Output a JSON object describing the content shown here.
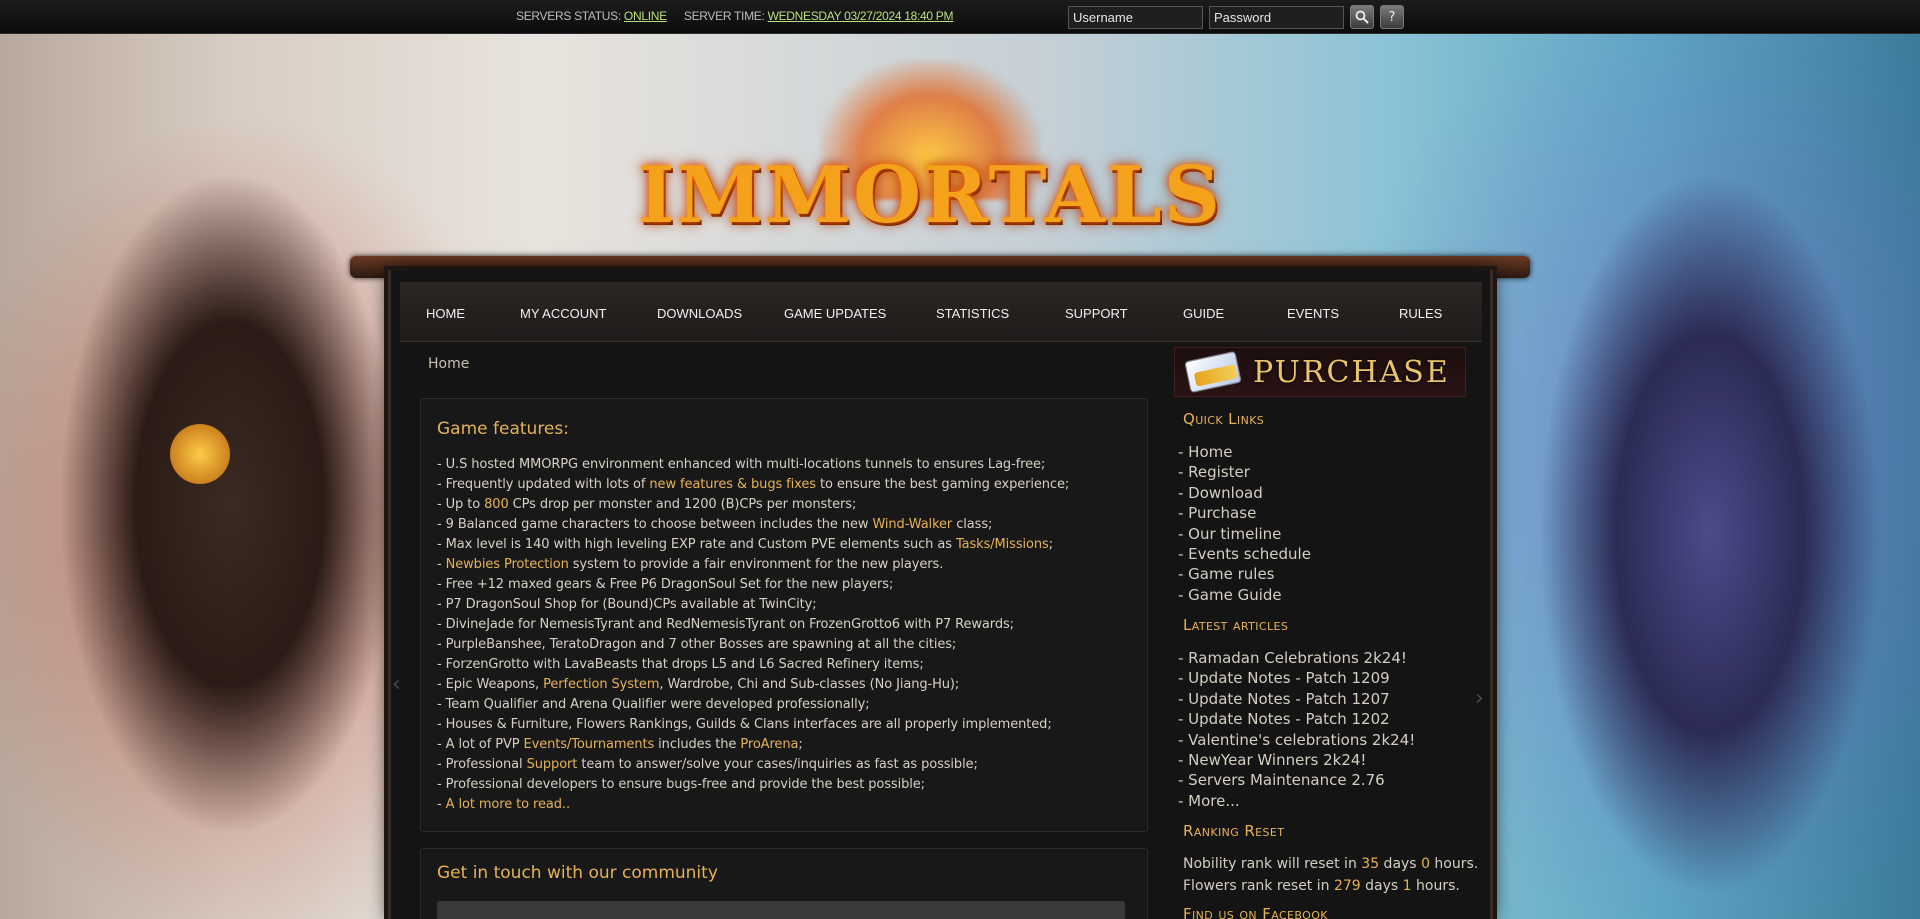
{
  "topbar": {
    "status_label": "SERVERS STATUS:",
    "status_value": "ONLINE",
    "time_label": "SERVER TIME:",
    "time_value": "WEDNESDAY 03/27/2024 18:40 PM",
    "username_placeholder": "Username",
    "password_placeholder": "Password",
    "login_icon": "search-icon",
    "help_icon": "question-icon",
    "help_glyph": "?"
  },
  "logo": {
    "text": "IMMORTALS"
  },
  "nav": {
    "items": [
      "HOME",
      "MY ACCOUNT",
      "DOWNLOADS",
      "GAME UPDATES",
      "STATISTICS",
      "SUPPORT",
      "GUIDE",
      "EVENTS",
      "RULES"
    ]
  },
  "breadcrumb": "Home",
  "features": {
    "title": "Game features:",
    "lines": [
      [
        {
          "t": "- U.S hosted MMORPG environment enhanced with multi-locations tunnels to ensures Lag-free;"
        }
      ],
      [
        {
          "t": "- Frequently updated with lots of "
        },
        {
          "t": "new features & bugs fixes",
          "hl": true
        },
        {
          "t": " to ensure the best gaming experience;"
        }
      ],
      [
        {
          "t": "- Up to "
        },
        {
          "t": "800",
          "hl": true
        },
        {
          "t": " CPs drop per monster and 1200 (B)CPs per monsters;"
        }
      ],
      [
        {
          "t": "- 9 Balanced game characters to choose between includes the new "
        },
        {
          "t": "Wind-Walker",
          "hl": true
        },
        {
          "t": " class;"
        }
      ],
      [
        {
          "t": "- Max level is 140 with high leveling EXP rate and Custom PVE elements such as "
        },
        {
          "t": "Tasks/Missions",
          "hl": true
        },
        {
          "t": ";"
        }
      ],
      [
        {
          "t": "- "
        },
        {
          "t": "Newbies Protection",
          "hl": true
        },
        {
          "t": " system to provide a fair environment for the new players."
        }
      ],
      [
        {
          "t": "- Free +12 maxed gears & Free P6 DragonSoul Set for the new players;"
        }
      ],
      [
        {
          "t": "- P7 DragonSoul Shop for (Bound)CPs available at TwinCity;"
        }
      ],
      [
        {
          "t": "- DivineJade for NemesisTyrant and RedNemesisTyrant on FrozenGrotto6 with P7 Rewards;"
        }
      ],
      [
        {
          "t": "- PurpleBanshee, TeratoDragon and 7 other Bosses are spawning at all the cities;"
        }
      ],
      [
        {
          "t": "- ForzenGrotto with LavaBeasts that drops L5 and L6 Sacred Refinery items;"
        }
      ],
      [
        {
          "t": "- Epic Weapons, "
        },
        {
          "t": "Perfection System",
          "hl": true
        },
        {
          "t": ", Wardrobe, Chi and Sub-classes (No Jiang-Hu);"
        }
      ],
      [
        {
          "t": "- Team Qualifier and Arena Qualifier were developed professionally;"
        }
      ],
      [
        {
          "t": "- Houses & Furniture, Flowers Rankings, Guilds & Clans interfaces are all properly implemented;"
        }
      ],
      [
        {
          "t": "- A lot of PVP "
        },
        {
          "t": "Events/Tournaments",
          "hl": true
        },
        {
          "t": " includes the "
        },
        {
          "t": "ProArena",
          "hl": true
        },
        {
          "t": ";"
        }
      ],
      [
        {
          "t": "- Professional "
        },
        {
          "t": "Support",
          "hl": true
        },
        {
          "t": " team to answer/solve your cases/inquiries as fast as possible;"
        }
      ],
      [
        {
          "t": "- Professional developers to ensure bugs-free and provide the best possible;"
        }
      ],
      [
        {
          "t": "- "
        },
        {
          "t": "A lot more to read..",
          "hl": true
        }
      ]
    ]
  },
  "community": {
    "title": "Get in touch with our community"
  },
  "sidebar": {
    "purchase_label": "PURCHASE",
    "purchase_icon": "credit-card-icon",
    "quick_links_title": "Quick Links",
    "quick_links": [
      "- Home",
      "- Register",
      "- Download",
      "- Purchase",
      "- Our timeline",
      "- Events schedule",
      "- Game rules",
      "- Game Guide"
    ],
    "latest_title": "Latest articles",
    "latest": [
      "- Ramadan Celebrations 2k24!",
      "- Update Notes - Patch 1209",
      "- Update Notes - Patch 1207",
      "- Update Notes - Patch 1202",
      "- Valentine's celebrations 2k24!",
      "- NewYear Winners 2k24!",
      "- Servers Maintenance 2.76",
      "- More..."
    ],
    "ranking_title": "Ranking Reset",
    "nobility": {
      "pre": "Nobility rank will reset in ",
      "days": "35",
      "mid": " days ",
      "hours": "0",
      "post": " hours."
    },
    "flowers": {
      "pre": "Flowers rank reset in ",
      "days": "279",
      "mid": " days ",
      "hours": "1",
      "post": " hours."
    },
    "facebook_title": "Find us on Facebook"
  },
  "colors": {
    "accent": "#e6b256",
    "status_green": "#b7e07b",
    "nav_text": "#f0f0f0"
  }
}
